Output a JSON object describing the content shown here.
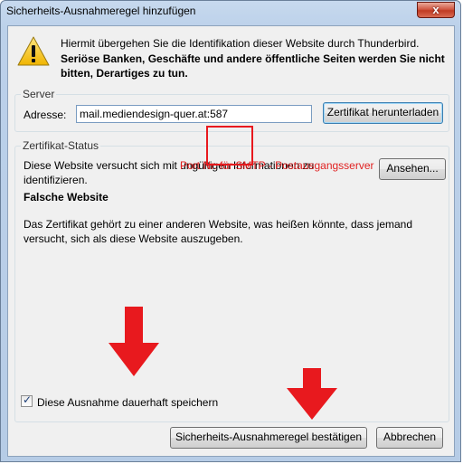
{
  "window": {
    "title": "Sicherheits-Ausnahmeregel hinzufügen",
    "close_glyph": "x"
  },
  "message": {
    "line1": "Hiermit übergehen Sie die Identifikation dieser Website durch Thunderbird.",
    "line2": "Seriöse Banken, Geschäfte und andere öffentliche Seiten werden Sie nicht bitten, Derartiges zu tun."
  },
  "server": {
    "legend": "Server",
    "address_label": "Adresse:",
    "address_value": "mail.mediendesign-quer.at:587",
    "download_button": "Zertifikat herunterladen"
  },
  "annotation": {
    "text": "Port Nr. für SMTP  - Postausgangsserver",
    "color": "#e02020"
  },
  "status": {
    "legend": "Zertifikat-Status",
    "text1": "Diese Website versucht sich mit ungültigen Informationen zu identifizieren.",
    "view_button": "Ansehen...",
    "heading": "Falsche Website",
    "text2": "Das Zertifikat gehört zu einer anderen Website, was heißen könnte, dass jemand versucht, sich als diese Website auszugeben."
  },
  "permanent": {
    "label": "Diese Ausnahme dauerhaft speichern",
    "checked": true
  },
  "buttons": {
    "confirm": "Sicherheits-Ausnahmeregel bestätigen",
    "cancel": "Abbrechen"
  },
  "icons": {
    "warning": "warning-icon",
    "arrow": "arrow-down-icon"
  }
}
